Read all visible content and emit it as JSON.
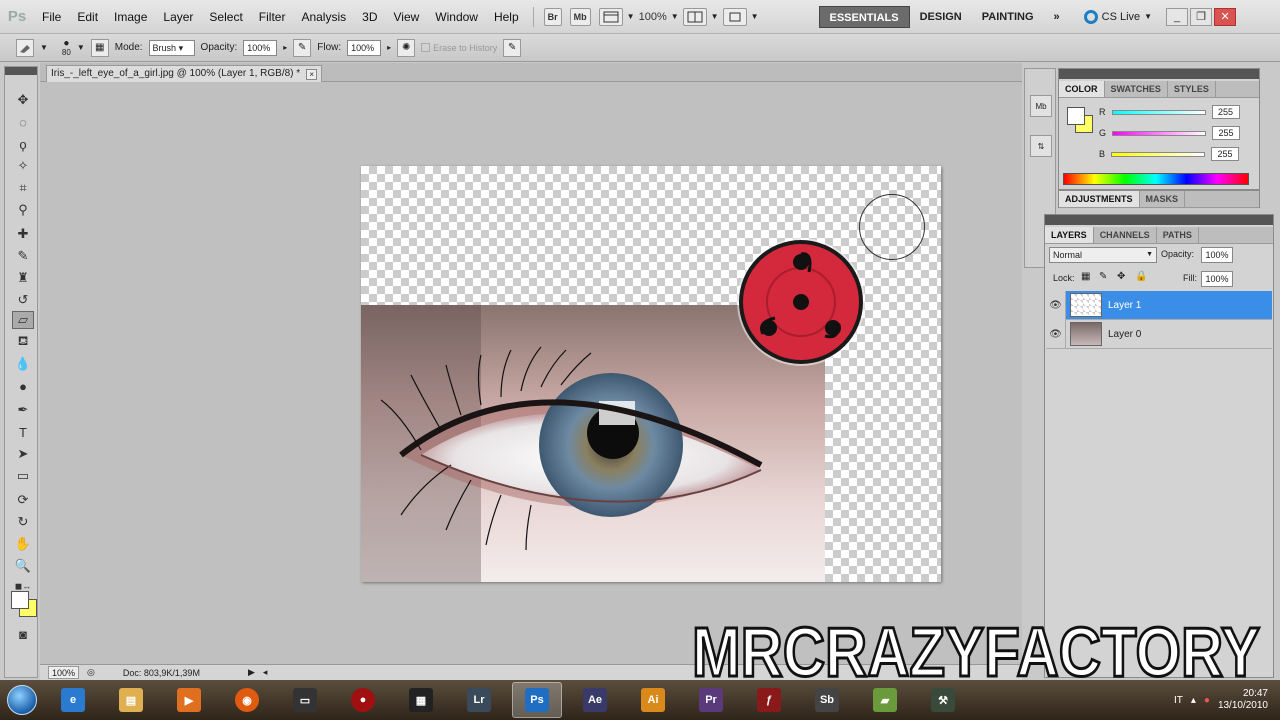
{
  "app": {
    "logo_text": "Ps",
    "menu": [
      "File",
      "Edit",
      "Image",
      "Layer",
      "Select",
      "Filter",
      "Analysis",
      "3D",
      "View",
      "Window",
      "Help"
    ],
    "bridge_label": "Br",
    "minibridge_label": "Mb",
    "zoom": "100%",
    "workspaces": [
      "ESSENTIALS",
      "DESIGN",
      "PAINTING"
    ],
    "workspace_overflow": "»",
    "cslive_label": "CS Live"
  },
  "options_bar": {
    "brush_size": "80",
    "mode_label": "Mode:",
    "mode_value": "Brush",
    "opacity_label": "Opacity:",
    "opacity_value": "100%",
    "flow_label": "Flow:",
    "flow_value": "100%",
    "erase_history_label": "Erase to History"
  },
  "document": {
    "tab_title": "Iris_-_left_eye_of_a_girl.jpg @ 100% (Layer 1, RGB/8) *",
    "tab_close": "×"
  },
  "status_bar": {
    "zoom": "100%",
    "doc_size": "Doc: 803,9K/1,39M"
  },
  "dock_icons": [
    "Mb",
    "history-icon"
  ],
  "color_panel": {
    "tabs": [
      "COLOR",
      "SWATCHES",
      "STYLES"
    ],
    "channels": [
      {
        "label": "R",
        "value": "255",
        "color": "#00e5ff"
      },
      {
        "label": "G",
        "value": "255",
        "color": "#ff00ff"
      },
      {
        "label": "B",
        "value": "255",
        "color": "#ffff00"
      }
    ],
    "foreground": "#ffffff",
    "background": "#ffff66"
  },
  "adjustments_panel": {
    "tabs": [
      "ADJUSTMENTS",
      "MASKS"
    ]
  },
  "layers_panel": {
    "tabs": [
      "LAYERS",
      "CHANNELS",
      "PATHS"
    ],
    "blend_mode": "Normal",
    "opacity_label": "Opacity:",
    "opacity_value": "100%",
    "lock_label": "Lock:",
    "fill_label": "Fill:",
    "fill_value": "100%",
    "layers": [
      {
        "name": "Layer 1",
        "selected": true
      },
      {
        "name": "Layer 0",
        "selected": false
      }
    ]
  },
  "taskbar": {
    "apps": [
      "ie-icon",
      "explorer-icon",
      "media-player-icon",
      "firefox-icon",
      "terminal-icon",
      "joystick-icon",
      "film-icon",
      "Lr",
      "Ps",
      "Ae",
      "Ai",
      "Pr",
      "flash-icon",
      "Sb",
      "folder-green-icon",
      "tool-icon"
    ],
    "app_colors": {
      "Lr": "#3a4a5a",
      "Ps": "#1f6ec2",
      "Ae": "#3a3a6a",
      "Ai": "#d98a1a",
      "Pr": "#5a3a7a",
      "Sb": "#444444"
    },
    "language": "IT",
    "time": "20:47",
    "date": "13/10/2010"
  },
  "watermark": {
    "text": "MRCRAZYFACTORY"
  }
}
